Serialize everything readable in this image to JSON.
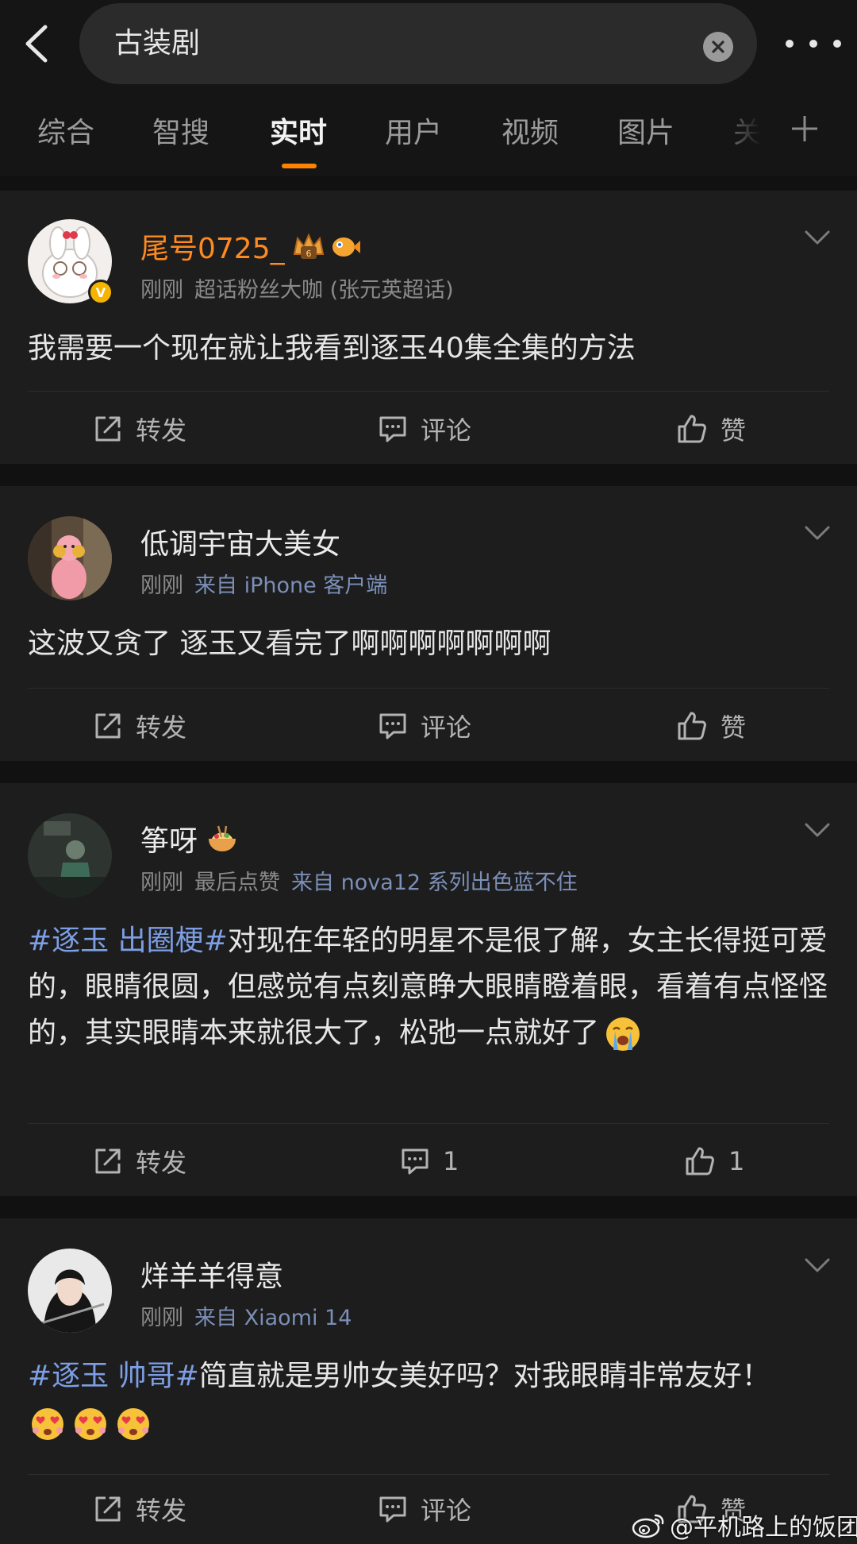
{
  "header": {
    "search_query": "古装剧"
  },
  "tabs": [
    "综合",
    "智搜",
    "实时",
    "用户",
    "视频",
    "图片",
    "关"
  ],
  "active_tab": "实时",
  "colors": {
    "accent": "#ff8200",
    "topic": "#7d9ee4",
    "vip_name": "#ff8a1f"
  },
  "posts": [
    {
      "username": "尾号0725_",
      "time": "刚刚",
      "meta_text": "超话粉丝大咖 (张元英超话)",
      "content": "我需要一个现在就让我看到逐玉40集全集的方法",
      "repost_label": "转发",
      "comment_label": "评论",
      "like_label": "赞"
    },
    {
      "username": "低调宇宙大美女",
      "time": "刚刚",
      "source": "来自 iPhone 客户端",
      "content": "这波又贪了 逐玉又看完了啊啊啊啊啊啊啊",
      "repost_label": "转发",
      "comment_label": "评论",
      "like_label": "赞"
    },
    {
      "username": "筝呀",
      "time": "刚刚",
      "meta_text": "最后点赞",
      "source": "来自 nova12 系列出色蓝不住",
      "topic": "#逐玉 出圈梗#",
      "content": "对现在年轻的明星不是很了解，女主长得挺可爱的，眼睛很圆，但感觉有点刻意睁大眼睛瞪着眼，看着有点怪怪的，其实眼睛本来就很大了，松弛一点就好了",
      "repost_label": "转发",
      "comment_count": "1",
      "like_count": "1"
    },
    {
      "username": "烊羊羊得意",
      "time": "刚刚",
      "source": "来自 Xiaomi 14",
      "topic": "#逐玉 帅哥#",
      "content": "简直就是男帅女美好吗？对我眼睛非常友好！",
      "repost_label": "转发",
      "comment_label": "评论",
      "like_label": "赞"
    }
  ],
  "watermark": "@平机路上的饭团"
}
